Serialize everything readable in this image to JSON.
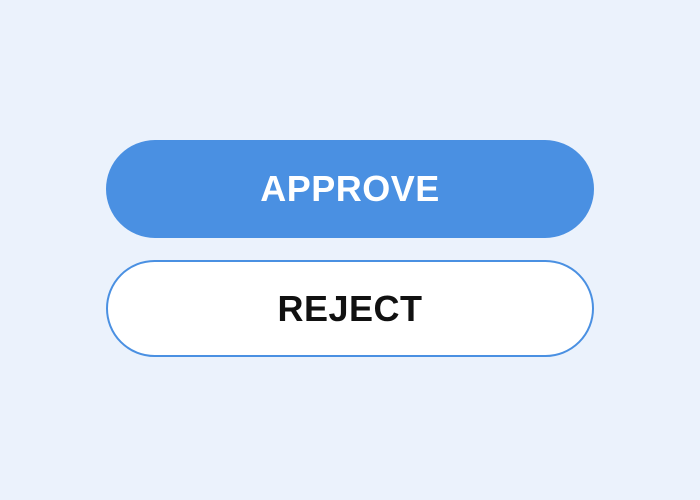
{
  "buttons": {
    "approve": {
      "label": "APPROVE"
    },
    "reject": {
      "label": "REJECT"
    }
  },
  "colors": {
    "background": "#ebf2fc",
    "accent": "#4a90e2",
    "approve_text": "#ffffff",
    "reject_background": "#ffffff",
    "reject_text": "#111111"
  }
}
